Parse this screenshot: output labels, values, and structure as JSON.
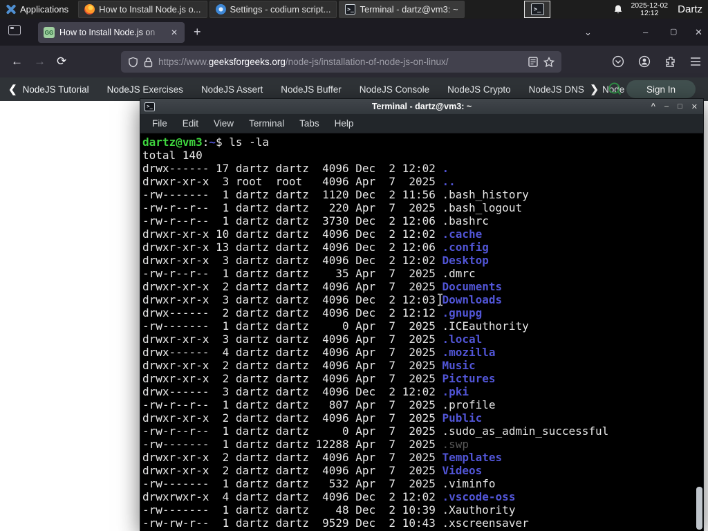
{
  "panel": {
    "applications_label": "Applications",
    "windows": [
      {
        "title": "How to Install Node.js o...",
        "icon": "firefox",
        "active": false
      },
      {
        "title": "Settings - codium script...",
        "icon": "codium",
        "active": false
      },
      {
        "title": "Terminal - dartz@vm3: ~",
        "icon": "terminal",
        "active": true
      }
    ],
    "launcher": "terminal-launcher",
    "clock_date": "2025-12-02",
    "clock_time": "12:12",
    "user": "Dartz"
  },
  "browser": {
    "tab": {
      "title": "How to Install Node.js on",
      "favicon_text": "GG"
    },
    "new_tab_label": "+",
    "window_controls": {
      "tabs_list": "⌄",
      "minimize": "–",
      "maximize": "▢",
      "close": "✕"
    },
    "nav": {
      "back": "←",
      "forward": "→",
      "reload": "⟳"
    },
    "url": {
      "scheme": "https://www.",
      "domain": "geeksforgeeks.org",
      "path": "/node-js/installation-of-node-js-on-linux/"
    }
  },
  "gfg_nav": {
    "left_chevron": "❮",
    "right_chevron": "❯",
    "links": [
      "NodeJS Tutorial",
      "NodeJS Exercises",
      "NodeJS Assert",
      "NodeJS Buffer",
      "NodeJS Console",
      "NodeJS Crypto",
      "NodeJS DNS",
      "Node"
    ],
    "sign_in": "Sign In",
    "accent_green": "#2f8d46"
  },
  "terminal": {
    "title": "Terminal - dartz@vm3: ~",
    "menu": [
      "File",
      "Edit",
      "View",
      "Terminal",
      "Tabs",
      "Help"
    ],
    "buttons": {
      "shade": "^",
      "minimize": "–",
      "maximize": "□",
      "close": "✕"
    },
    "colors": {
      "background": "#000000",
      "foreground": "#e6e6e6",
      "prompt_green": "#3ed43e",
      "dir_blue": "#5155d6",
      "dim": "#585858"
    },
    "prompt": {
      "userhost": "dartz@vm3",
      "colon": ":",
      "cwd": "~",
      "dollar": "$",
      "command": "ls -la"
    },
    "total_line": "total 140",
    "listing": [
      {
        "pre": "drwx------ 17 dartz dartz  4096 Dec  2 12:02 ",
        "name": ".",
        "type": "dir"
      },
      {
        "pre": "drwxr-xr-x  3 root  root   4096 Apr  7  2025 ",
        "name": "..",
        "type": "dir"
      },
      {
        "pre": "-rw-------  1 dartz dartz  1120 Dec  2 11:56 ",
        "name": ".bash_history",
        "type": "file"
      },
      {
        "pre": "-rw-r--r--  1 dartz dartz   220 Apr  7  2025 ",
        "name": ".bash_logout",
        "type": "file"
      },
      {
        "pre": "-rw-r--r--  1 dartz dartz  3730 Dec  2 12:06 ",
        "name": ".bashrc",
        "type": "file"
      },
      {
        "pre": "drwxr-xr-x 10 dartz dartz  4096 Dec  2 12:02 ",
        "name": ".cache",
        "type": "dir"
      },
      {
        "pre": "drwxr-xr-x 13 dartz dartz  4096 Dec  2 12:06 ",
        "name": ".config",
        "type": "dir"
      },
      {
        "pre": "drwxr-xr-x  3 dartz dartz  4096 Dec  2 12:02 ",
        "name": "Desktop",
        "type": "dir"
      },
      {
        "pre": "-rw-r--r--  1 dartz dartz    35 Apr  7  2025 ",
        "name": ".dmrc",
        "type": "file"
      },
      {
        "pre": "drwxr-xr-x  2 dartz dartz  4096 Apr  7  2025 ",
        "name": "Documents",
        "type": "dir"
      },
      {
        "pre": "drwxr-xr-x  3 dartz dartz  4096 Dec  2 12:03 ",
        "name": "Downloads",
        "type": "dir"
      },
      {
        "pre": "drwx------  2 dartz dartz  4096 Dec  2 12:12 ",
        "name": ".gnupg",
        "type": "dir"
      },
      {
        "pre": "-rw-------  1 dartz dartz     0 Apr  7  2025 ",
        "name": ".ICEauthority",
        "type": "file"
      },
      {
        "pre": "drwxr-xr-x  3 dartz dartz  4096 Apr  7  2025 ",
        "name": ".local",
        "type": "dir"
      },
      {
        "pre": "drwx------  4 dartz dartz  4096 Apr  7  2025 ",
        "name": ".mozilla",
        "type": "dir"
      },
      {
        "pre": "drwxr-xr-x  2 dartz dartz  4096 Apr  7  2025 ",
        "name": "Music",
        "type": "dir"
      },
      {
        "pre": "drwxr-xr-x  2 dartz dartz  4096 Apr  7  2025 ",
        "name": "Pictures",
        "type": "dir"
      },
      {
        "pre": "drwx------  3 dartz dartz  4096 Dec  2 12:02 ",
        "name": ".pki",
        "type": "dir"
      },
      {
        "pre": "-rw-r--r--  1 dartz dartz   807 Apr  7  2025 ",
        "name": ".profile",
        "type": "file"
      },
      {
        "pre": "drwxr-xr-x  2 dartz dartz  4096 Apr  7  2025 ",
        "name": "Public",
        "type": "dir"
      },
      {
        "pre": "-rw-r--r--  1 dartz dartz     0 Apr  7  2025 ",
        "name": ".sudo_as_admin_successful",
        "type": "file"
      },
      {
        "pre": "-rw-------  1 dartz dartz 12288 Apr  7  2025 ",
        "name": ".swp",
        "type": "dim"
      },
      {
        "pre": "drwxr-xr-x  2 dartz dartz  4096 Apr  7  2025 ",
        "name": "Templates",
        "type": "dir"
      },
      {
        "pre": "drwxr-xr-x  2 dartz dartz  4096 Apr  7  2025 ",
        "name": "Videos",
        "type": "dir"
      },
      {
        "pre": "-rw-------  1 dartz dartz   532 Apr  7  2025 ",
        "name": ".viminfo",
        "type": "file"
      },
      {
        "pre": "drwxrwxr-x  4 dartz dartz  4096 Dec  2 12:02 ",
        "name": ".vscode-oss",
        "type": "dir"
      },
      {
        "pre": "-rw-------  1 dartz dartz    48 Dec  2 10:39 ",
        "name": ".Xauthority",
        "type": "file"
      },
      {
        "pre": "-rw-rw-r--  1 dartz dartz  9529 Dec  2 10:43 ",
        "name": ".xscreensaver",
        "type": "file"
      }
    ]
  }
}
